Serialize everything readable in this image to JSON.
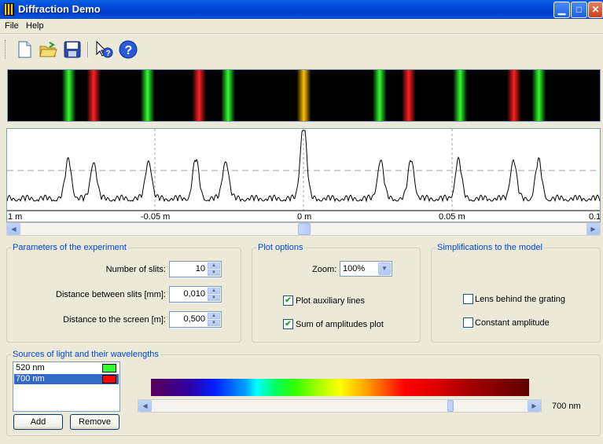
{
  "window": {
    "title": "Diffraction Demo"
  },
  "menu": {
    "items": [
      "File",
      "Help"
    ]
  },
  "toolbar": {
    "buttons": [
      "new-file-icon",
      "open-folder-icon",
      "save-icon",
      "context-help-icon",
      "help-icon"
    ]
  },
  "spectrum": {
    "lines": [
      {
        "pos": 0.103,
        "color": "#30ff30"
      },
      {
        "pos": 0.145,
        "color": "#ff2020"
      },
      {
        "pos": 0.236,
        "color": "#30ff30"
      },
      {
        "pos": 0.323,
        "color": "#ff2020"
      },
      {
        "pos": 0.372,
        "color": "#30ff30"
      },
      {
        "pos": 0.5,
        "color": "#ffc000"
      },
      {
        "pos": 0.628,
        "color": "#30ff30"
      },
      {
        "pos": 0.677,
        "color": "#ff2020"
      },
      {
        "pos": 0.764,
        "color": "#30ff30"
      },
      {
        "pos": 0.855,
        "color": "#ff2020"
      },
      {
        "pos": 0.897,
        "color": "#30ff30"
      }
    ]
  },
  "plot": {
    "tick_labels": [
      "1 m",
      "-0.05 m",
      "0 m",
      "0.05 m",
      "0.1"
    ]
  },
  "params": {
    "title": "Parameters of the experiment",
    "slits_label": "Number of slits:",
    "slits_value": "10",
    "distance_label": "Distance between slits [mm]:",
    "distance_value": "0,010",
    "screen_label": "Distance to the screen [m]:",
    "screen_value": "0,500"
  },
  "plot_options": {
    "title": "Plot options",
    "zoom_label": "Zoom:",
    "zoom_value": "100%",
    "aux_lines_label": "Plot auxiliary lines",
    "aux_lines_checked": true,
    "sum_label": "Sum of amplitudes plot",
    "sum_checked": true
  },
  "simplifications": {
    "title": "Simplifications to the model",
    "lens_label": "Lens behind the grating",
    "lens_checked": false,
    "amplitude_label": "Constant amplitude",
    "amplitude_checked": false
  },
  "sources": {
    "title": "Sources of light and their wavelengths",
    "items": [
      {
        "label": "520 nm",
        "color": "#30ff30",
        "selected": false
      },
      {
        "label": "700 nm",
        "color": "#ff0000",
        "selected": true
      }
    ],
    "add_label": "Add",
    "remove_label": "Remove",
    "wavelength_readout": "700 nm",
    "slider_fraction": 0.8
  },
  "colors": {
    "accent": "#0046d5",
    "selection": "#316ac5"
  }
}
